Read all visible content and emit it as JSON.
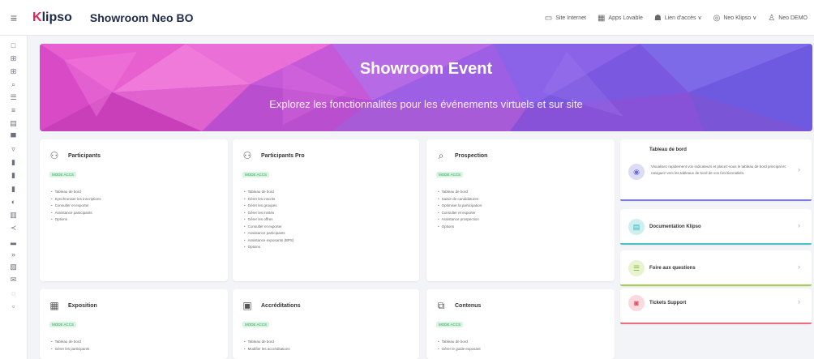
{
  "header": {
    "logo_prefix": "K",
    "logo_rest": "lipso",
    "title": "Showroom Neo BO",
    "actions": [
      {
        "icon": "monitor-icon",
        "label": "Site Internet"
      },
      {
        "icon": "grid-icon",
        "label": "Apps Lovable"
      },
      {
        "icon": "users-icon",
        "label": "Lien d'accès ∨"
      },
      {
        "icon": "globe-icon",
        "label": "Neo Klipso ∨"
      },
      {
        "icon": "user-icon",
        "label": "Neo DEMO"
      }
    ]
  },
  "banner": {
    "title": "Showroom Event",
    "subtitle": "Explorez les fonctionnalités pour les événements virtuels et sur site"
  },
  "cards": {
    "participants": {
      "title": "Participants",
      "tag": "MODE ACCS",
      "items": [
        "Tableau de bord",
        "Synchroniser les inscriptions",
        "Consulter et exporter",
        "Assistance participants",
        "Options"
      ]
    },
    "participants_pro": {
      "title": "Participants Pro",
      "tag": "MODE ACCS",
      "items": [
        "Tableau de bord",
        "Gérer les inscrits",
        "Gérer les groupes",
        "Gérer les invités",
        "Gérer les offres",
        "Consulter et exporter",
        "Assistance participants",
        "Assistance exposants (BPS)",
        "Options"
      ]
    },
    "prospection": {
      "title": "Prospection",
      "tag": "MODE ACCS",
      "items": [
        "Tableau de bord",
        "Saisie de candidatures",
        "Optimiser la participation",
        "Consulter et exporter",
        "Assistance prospection",
        "Options"
      ]
    },
    "exposition": {
      "title": "Exposition",
      "tag": "MODE ACCS",
      "items": [
        "Tableau de bord",
        "Gérer les participants"
      ]
    },
    "accreditations": {
      "title": "Accréditations",
      "tag": "MODE ACCS",
      "items": [
        "Tableau de bord",
        "Modifier les accréditations"
      ]
    },
    "contenus": {
      "title": "Contenus",
      "tag": "MODE ACCS",
      "items": [
        "Tableau de bord",
        "Gérer le guide exposant"
      ]
    }
  },
  "right": {
    "dashboard": {
      "title": "Tableau de bord",
      "description": "Visualisez rapidement vos indicateurs et placez-vous le tableau de bord principal et naviguez vers les tableaux de bord de vos fonctionnalités."
    },
    "docs": {
      "title": "Documentation Klipso"
    },
    "faq": {
      "title": "Foire aux questions"
    },
    "tickets": {
      "title": "Tickets Support"
    }
  }
}
